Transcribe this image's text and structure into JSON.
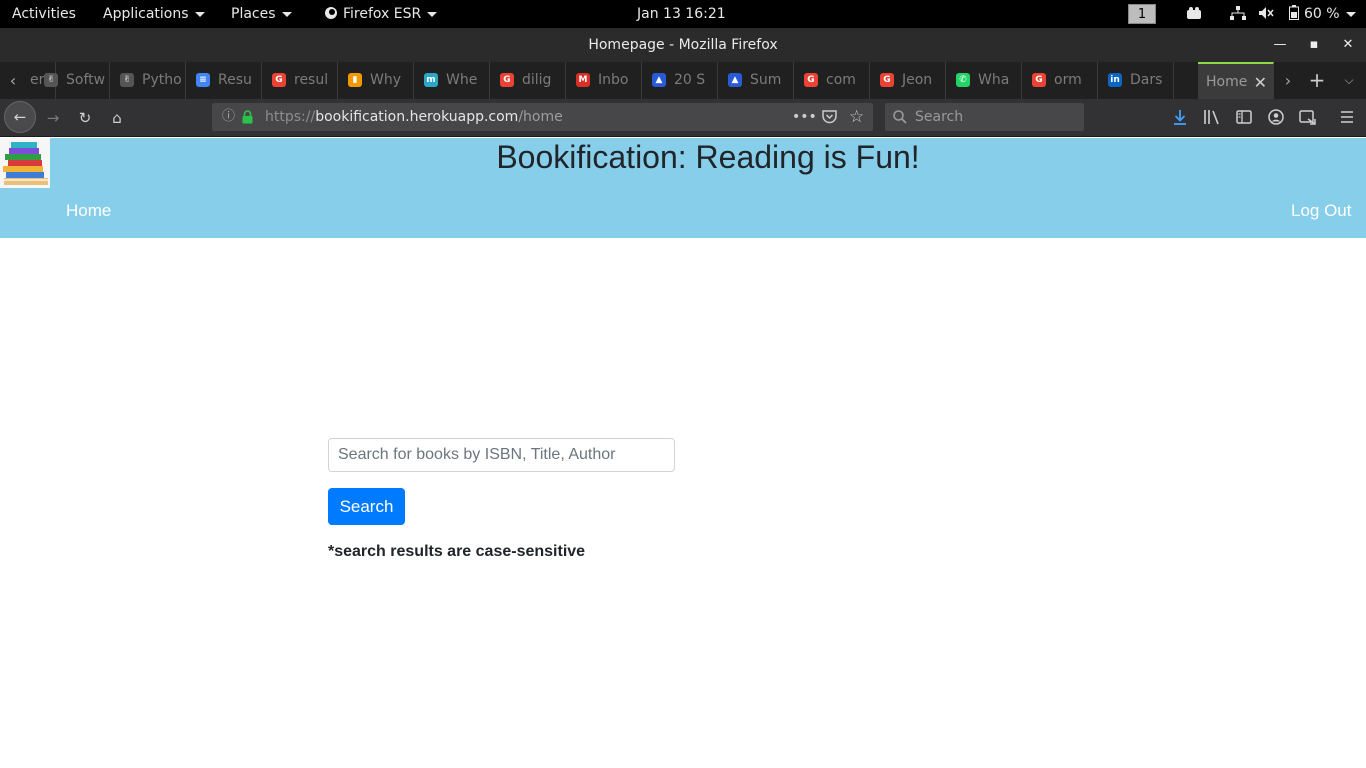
{
  "system": {
    "activities": "Activities",
    "applications": "Applications",
    "places": "Places",
    "app_menu": "Firefox ESR",
    "clock": "Jan 13  16:21",
    "workspace": "1",
    "battery": "60 %"
  },
  "window": {
    "title": "Homepage - Mozilla Firefox"
  },
  "tabs": [
    {
      "label": "ers",
      "icon": "generic-page-icon",
      "color": "#555555"
    },
    {
      "label": "Softw",
      "icon": "hand-icon",
      "color": "#555555"
    },
    {
      "label": "Pytho",
      "icon": "hand-icon",
      "color": "#555555"
    },
    {
      "label": "Resu",
      "icon": "docs-icon",
      "color": "#4285f4"
    },
    {
      "label": "resul",
      "icon": "google-icon",
      "color": "#ea4335"
    },
    {
      "label": "Why",
      "icon": "page-icon",
      "color": "#f29900"
    },
    {
      "label": "Whe",
      "icon": "m-icon",
      "color": "#2aa6c7"
    },
    {
      "label": "dilig",
      "icon": "google-icon",
      "color": "#ea4335"
    },
    {
      "label": "Inbo",
      "icon": "gmail-icon",
      "color": "#d93025"
    },
    {
      "label": "20 S",
      "icon": "graduation-icon",
      "color": "#2a5bd7"
    },
    {
      "label": "Sum",
      "icon": "graduation-icon",
      "color": "#2a5bd7"
    },
    {
      "label": "com",
      "icon": "google-icon",
      "color": "#ea4335"
    },
    {
      "label": "Jeon",
      "icon": "google-icon",
      "color": "#ea4335"
    },
    {
      "label": "Wha",
      "icon": "whatsapp-icon",
      "color": "#25d366"
    },
    {
      "label": "orm",
      "icon": "google-icon",
      "color": "#ea4335"
    },
    {
      "label": "Dars",
      "icon": "linkedin-icon",
      "color": "#0a66c2"
    },
    {
      "label": "Home",
      "icon": "",
      "color": "",
      "active": true
    }
  ],
  "nav": {
    "url_protocol": "https://",
    "url_host": "bookification.herokuapp.com",
    "url_path": "/home",
    "search_placeholder": "Search"
  },
  "site": {
    "title": "Bookification: Reading is Fun!",
    "nav_home": "Home",
    "nav_logout": "Log Out",
    "header_color": "#87ceeb",
    "search_placeholder": "Search for books by ISBN, Title, Author",
    "search_button": "Search",
    "note": "*search results are case-sensitive"
  }
}
